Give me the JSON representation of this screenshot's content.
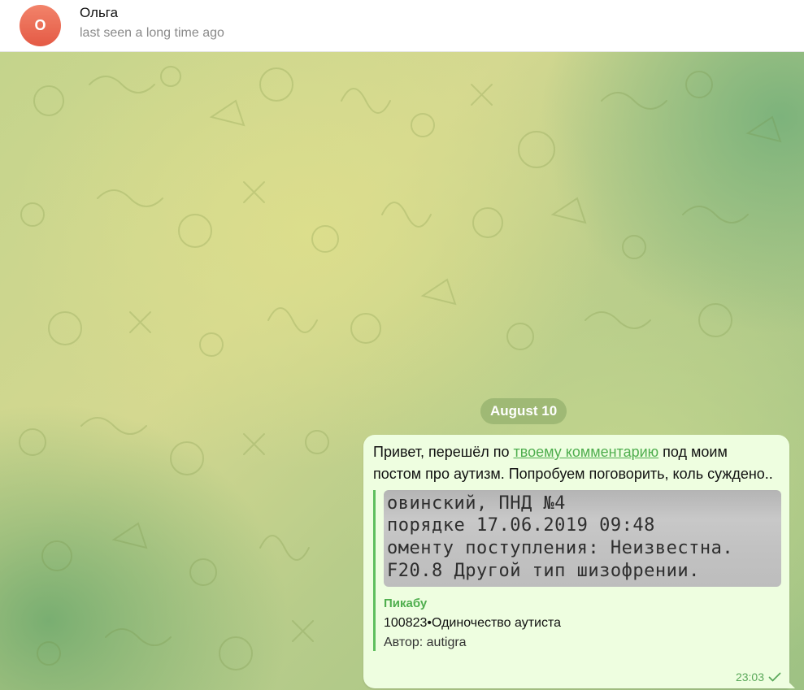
{
  "contact": {
    "initial": "О",
    "name": "Ольга",
    "status": "last seen a long time ago",
    "avatar_color": "#e45a45"
  },
  "chat": {
    "date_label": "August 10",
    "message": {
      "text_before_link": "Привет, перешёл по ",
      "link_text": "твоему комментарию",
      "text_after_link": " под моим постом про аутизм. Попробуем поговорить, коль суждено..",
      "time": "23:03",
      "status_icon": "check-icon",
      "link_preview": {
        "image_lines": [
          "         ",
          "овинский, ПНД №4",
          " порядке 17.06.2019 09:48",
          "оменту поступления: Неизвестна.",
          " F20.8 Другой тип шизофрении."
        ],
        "site_name": "Пикабу",
        "title": "100823•Одиночество аутиста",
        "description": "Автор: autigra"
      }
    }
  },
  "colors": {
    "bubble_bg": "#eefee0",
    "accent_green": "#4fae4e",
    "date_pill_bg": "#96b26e"
  }
}
